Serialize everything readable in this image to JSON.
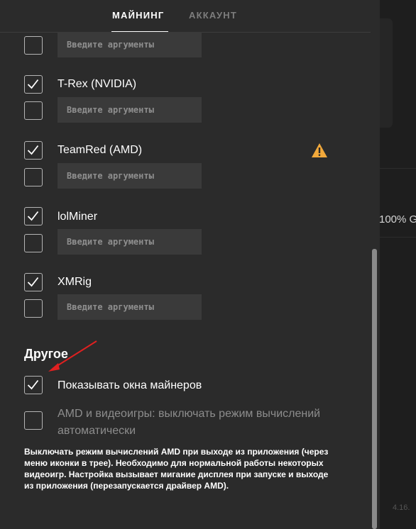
{
  "tabs": [
    {
      "label": "МАЙНИНГ",
      "active": true
    },
    {
      "label": "АККАУНТ",
      "active": false
    }
  ],
  "arg_placeholder": "Введите аргументы",
  "miners": [
    {
      "name": "T-Rex (NVIDIA)",
      "checked": true,
      "args_checked": false
    },
    {
      "name": "TeamRed (AMD)",
      "checked": true,
      "args_checked": false,
      "warning": true
    },
    {
      "name": "lolMiner",
      "checked": true,
      "args_checked": false
    },
    {
      "name": "XMRig",
      "checked": true,
      "args_checked": false
    }
  ],
  "other": {
    "title": "Другое",
    "show_windows_label": "Показывать окна майнеров",
    "show_windows_checked": true,
    "amd_games_label": "AMD и видеоигры: выключать режим вычислений автоматически",
    "amd_games_checked": false,
    "note": "Выключать режим вычислений AMD при выходе из приложения (через меню иконки в трее). Необходимо для нормальной работы некоторых видеоигр. Настройка вызывает мигание дисплея при запуске и выходе из приложения (перезапускается драйвер AMD)."
  },
  "background": {
    "partial_text": "100% G",
    "version_partial": "4.16."
  },
  "colors": {
    "panel_bg": "#2b2b2b",
    "input_bg": "#3a3a3a",
    "warning": "#f2a93b",
    "annotation_arrow": "#e02020"
  }
}
